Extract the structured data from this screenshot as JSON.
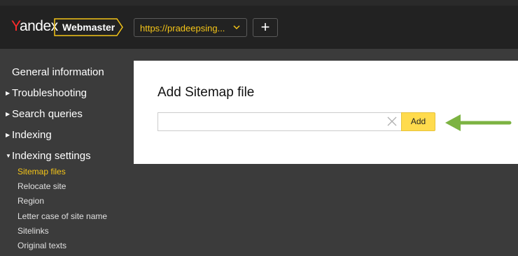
{
  "header": {
    "logo_text": "andex",
    "logo_y": "Y",
    "product_label": "Webmaster",
    "site_url": "https://pradeepsing...",
    "add_site_symbol": "+",
    "icons": {
      "site_dropdown": "chevron-down-icon",
      "add_site": "plus-icon"
    }
  },
  "sidebar": {
    "items": [
      {
        "label": "General information",
        "expandable": false
      },
      {
        "label": "Troubleshooting",
        "expandable": true,
        "expanded": false
      },
      {
        "label": "Search queries",
        "expandable": true,
        "expanded": false
      },
      {
        "label": "Indexing",
        "expandable": true,
        "expanded": false
      },
      {
        "label": "Indexing settings",
        "expandable": true,
        "expanded": true
      }
    ],
    "subitems": [
      {
        "label": "Sitemap files",
        "active": true
      },
      {
        "label": "Relocate site",
        "active": false
      },
      {
        "label": "Region",
        "active": false
      },
      {
        "label": "Letter case of site name",
        "active": false
      },
      {
        "label": "Sitelinks",
        "active": false
      },
      {
        "label": "Original texts",
        "active": false
      }
    ]
  },
  "main": {
    "title": "Add Sitemap file",
    "input_value": "",
    "add_button_label": "Add"
  },
  "colors": {
    "accent_yellow": "#f5c518",
    "add_button_bg": "#ffdb4d",
    "arrow_green": "#7cb342",
    "header_bg": "#222222",
    "sidebar_bg": "#3b3b3b",
    "yandex_red": "#ff2a2a"
  }
}
